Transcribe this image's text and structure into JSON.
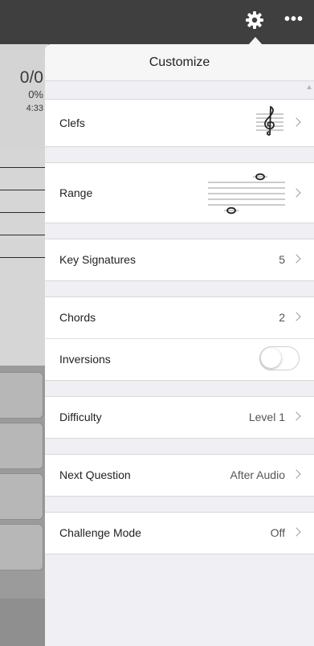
{
  "top_bar": {
    "settings_icon": "gear-icon",
    "more_icon": "more-dots-icon",
    "more_glyph": "•••"
  },
  "background_app": {
    "score": "0/0",
    "percent": "0%",
    "time": "4:33"
  },
  "popover": {
    "title": "Customize",
    "rows": {
      "clefs": {
        "label": "Clefs"
      },
      "range": {
        "label": "Range"
      },
      "key_signatures": {
        "label": "Key Signatures",
        "value": "5"
      },
      "chords": {
        "label": "Chords",
        "value": "2"
      },
      "inversions": {
        "label": "Inversions",
        "toggle_on": false
      },
      "difficulty": {
        "label": "Difficulty",
        "value": "Level 1"
      },
      "next_question": {
        "label": "Next Question",
        "value": "After Audio"
      },
      "challenge_mode": {
        "label": "Challenge Mode",
        "value": "Off"
      }
    }
  },
  "colors": {
    "top_bar": "#3f3f3f",
    "panel_bg": "#efeff4",
    "cell_bg": "#ffffff",
    "chevron": "#9a9a9a"
  }
}
